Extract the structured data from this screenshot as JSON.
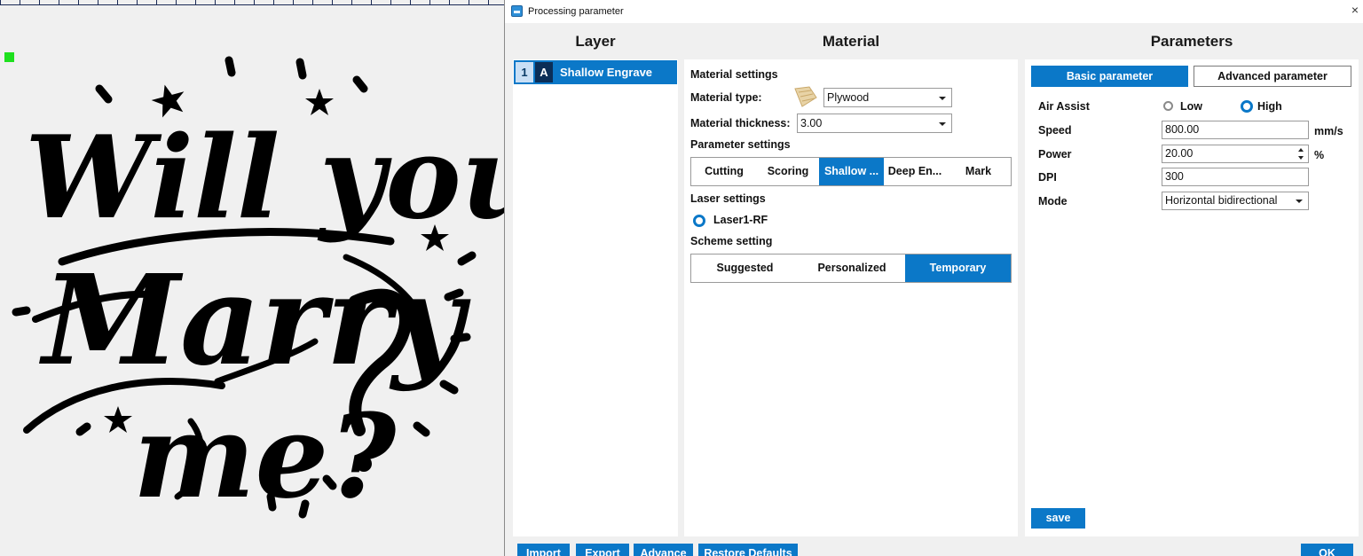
{
  "dialog": {
    "title": "Processing parameter",
    "close_glyph": "×",
    "icon": "app-icon"
  },
  "columns": {
    "layer": "Layer",
    "material": "Material",
    "parameters": "Parameters"
  },
  "layers": [
    {
      "number": "1",
      "mode": "A",
      "name": "Shallow Engrave"
    }
  ],
  "material": {
    "section_title": "Material settings",
    "type_label": "Material type:",
    "type_value": "Plywood",
    "type_icon": "plywood-icon",
    "thickness_label": "Material thickness:",
    "thickness_value": "3.00",
    "param_section_title": "Parameter settings",
    "process_tabs": [
      "Cutting",
      "Scoring",
      "Shallow ...",
      "Deep En...",
      "Mark"
    ],
    "process_selected": "Shallow ...",
    "laser_section_title": "Laser settings",
    "laser_option": "Laser1-RF",
    "scheme_section_title": "Scheme setting",
    "scheme_tabs": [
      "Suggested",
      "Personalized",
      "Temporary"
    ],
    "scheme_selected": "Temporary"
  },
  "parameters": {
    "tabs": [
      "Basic parameter",
      "Advanced parameter"
    ],
    "tab_selected": "Basic parameter",
    "air_assist_label": "Air Assist",
    "air_assist_options": [
      "Low",
      "High"
    ],
    "air_assist_selected": "High",
    "speed_label": "Speed",
    "speed_value": "800.00",
    "speed_unit": "mm/s",
    "power_label": "Power",
    "power_value": "20.00",
    "power_unit": "%",
    "dpi_label": "DPI",
    "dpi_value": "300",
    "mode_label": "Mode",
    "mode_value": "Horizontal bidirectional",
    "save_label": "save"
  },
  "footer": {
    "import_label": "Import",
    "export_label": "Export",
    "advance_label": "Advance",
    "restore_label": "Restore Defaults",
    "ok_label": "OK"
  },
  "canvas": {
    "art_lines": [
      "Will you",
      "Marry",
      "me?"
    ]
  },
  "colors": {
    "accent": "#0b78c8",
    "handle": "#1ee01e",
    "layer_mode_bg": "#0b2e57"
  }
}
